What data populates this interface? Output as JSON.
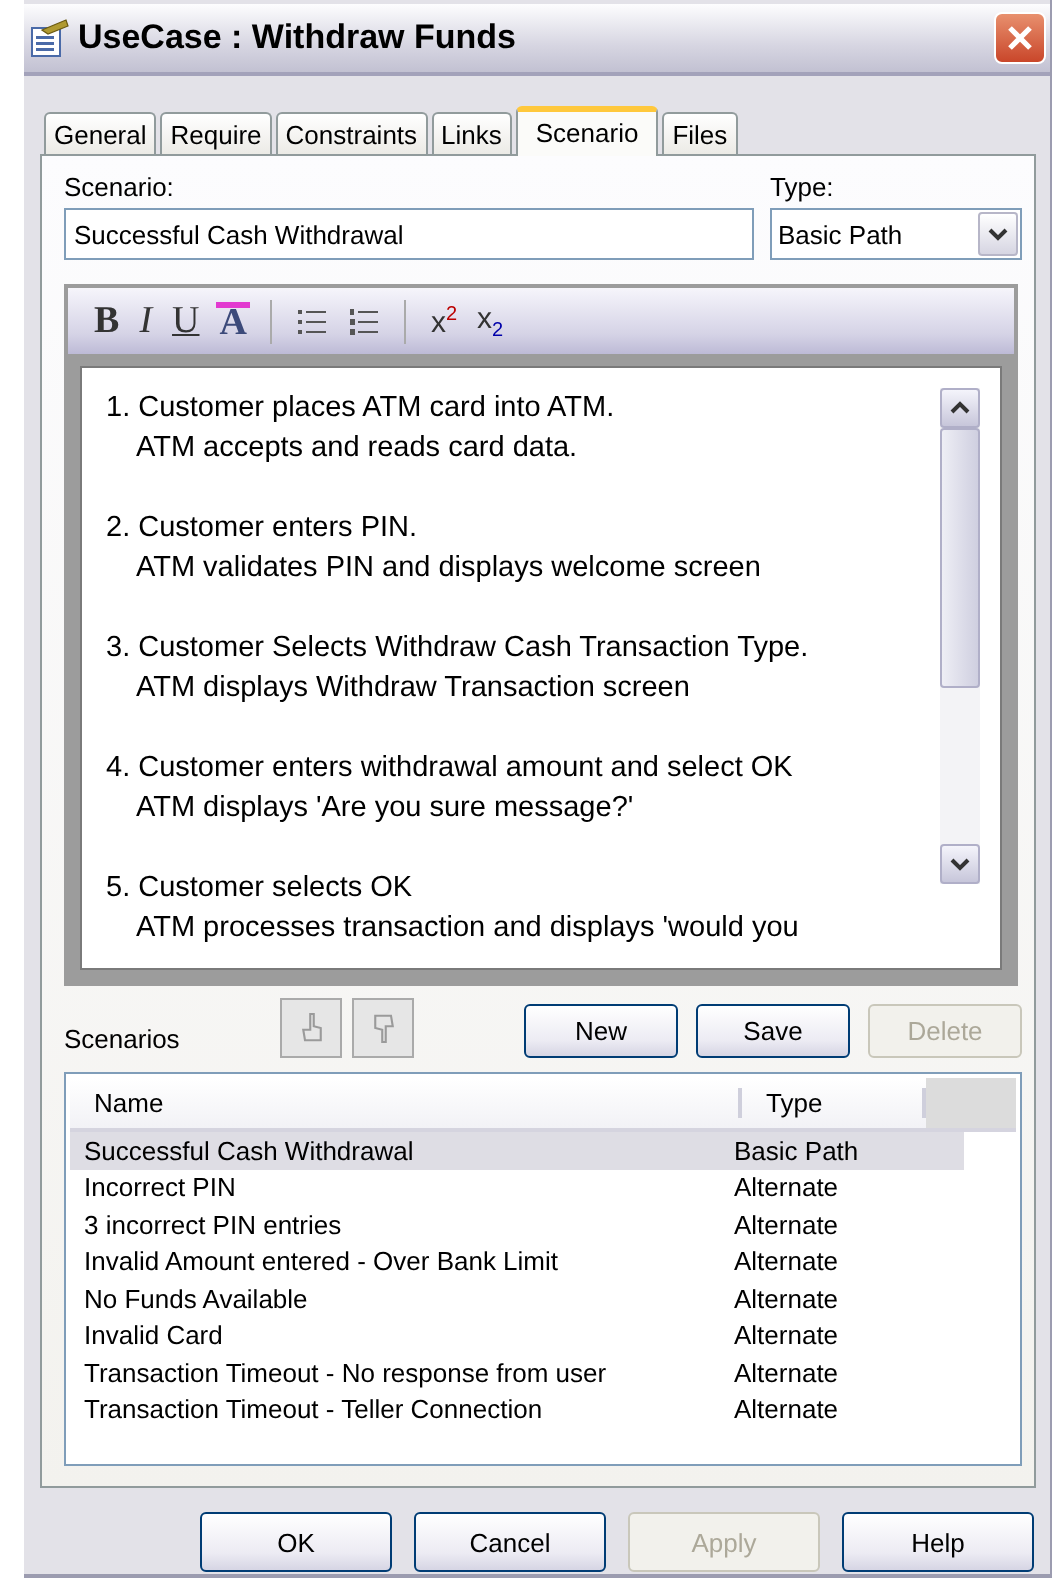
{
  "window": {
    "title": "UseCase : Withdraw Funds"
  },
  "tabs": [
    {
      "label": "General",
      "selected": false
    },
    {
      "label": "Require",
      "selected": false
    },
    {
      "label": "Constraints",
      "selected": false
    },
    {
      "label": "Links",
      "selected": false
    },
    {
      "label": "Scenario",
      "selected": true
    },
    {
      "label": "Files",
      "selected": false
    }
  ],
  "scenario_field": {
    "label": "Scenario:",
    "value": "Successful Cash Withdrawal"
  },
  "type_field": {
    "label": "Type:",
    "value": "Basic Path"
  },
  "toolbar": [
    {
      "kind": "bold",
      "label": "B"
    },
    {
      "kind": "italic",
      "label": "I"
    },
    {
      "kind": "underline",
      "label": "U"
    },
    {
      "kind": "font-color",
      "label": "A"
    },
    {
      "kind": "separator"
    },
    {
      "kind": "bullets"
    },
    {
      "kind": "numbering"
    },
    {
      "kind": "separator"
    },
    {
      "kind": "superscript",
      "label": "x",
      "index": "2"
    },
    {
      "kind": "subscript",
      "label": "x",
      "index": "2"
    }
  ],
  "steps": [
    {
      "action": "1. Customer places ATM card into ATM.",
      "response": "ATM accepts and reads card data."
    },
    {
      "action": "2. Customer enters PIN.",
      "response": "ATM validates PIN and displays welcome screen"
    },
    {
      "action": "3. Customer Selects Withdraw Cash Transaction Type.",
      "response": "ATM displays Withdraw Transaction screen"
    },
    {
      "action": "4. Customer enters withdrawal amount and select OK",
      "response": "ATM displays 'Are you sure message?'"
    },
    {
      "action": "5. Customer selects OK",
      "response": "ATM processes transaction and displays 'would you"
    }
  ],
  "scenarios_label": "Scenarios",
  "move_buttons": [
    {
      "kind": "up",
      "disabled": true
    },
    {
      "kind": "down",
      "disabled": true
    }
  ],
  "scenario_buttons": [
    {
      "label": "New",
      "disabled": false
    },
    {
      "label": "Save",
      "disabled": false
    },
    {
      "label": "Delete",
      "disabled": true
    }
  ],
  "table": {
    "columns": [
      "Name",
      "Type"
    ],
    "rows": [
      {
        "name": "Successful Cash Withdrawal",
        "type": "Basic Path",
        "selected": true
      },
      {
        "name": "Incorrect PIN",
        "type": "Alternate",
        "selected": false
      },
      {
        "name": "3 incorrect PIN entries",
        "type": "Alternate",
        "selected": false
      },
      {
        "name": "Invalid Amount entered - Over Bank Limit",
        "type": "Alternate",
        "selected": false
      },
      {
        "name": "No Funds Available",
        "type": "Alternate",
        "selected": false
      },
      {
        "name": "Invalid Card",
        "type": "Alternate",
        "selected": false
      },
      {
        "name": "Transaction Timeout - No response from user",
        "type": "Alternate",
        "selected": false
      },
      {
        "name": "Transaction Timeout - Teller Connection",
        "type": "Alternate",
        "selected": false
      }
    ]
  },
  "buttons": [
    {
      "label": "OK",
      "disabled": false
    },
    {
      "label": "Cancel",
      "disabled": false
    },
    {
      "label": "Apply",
      "disabled": true
    },
    {
      "label": "Help",
      "disabled": false
    }
  ]
}
